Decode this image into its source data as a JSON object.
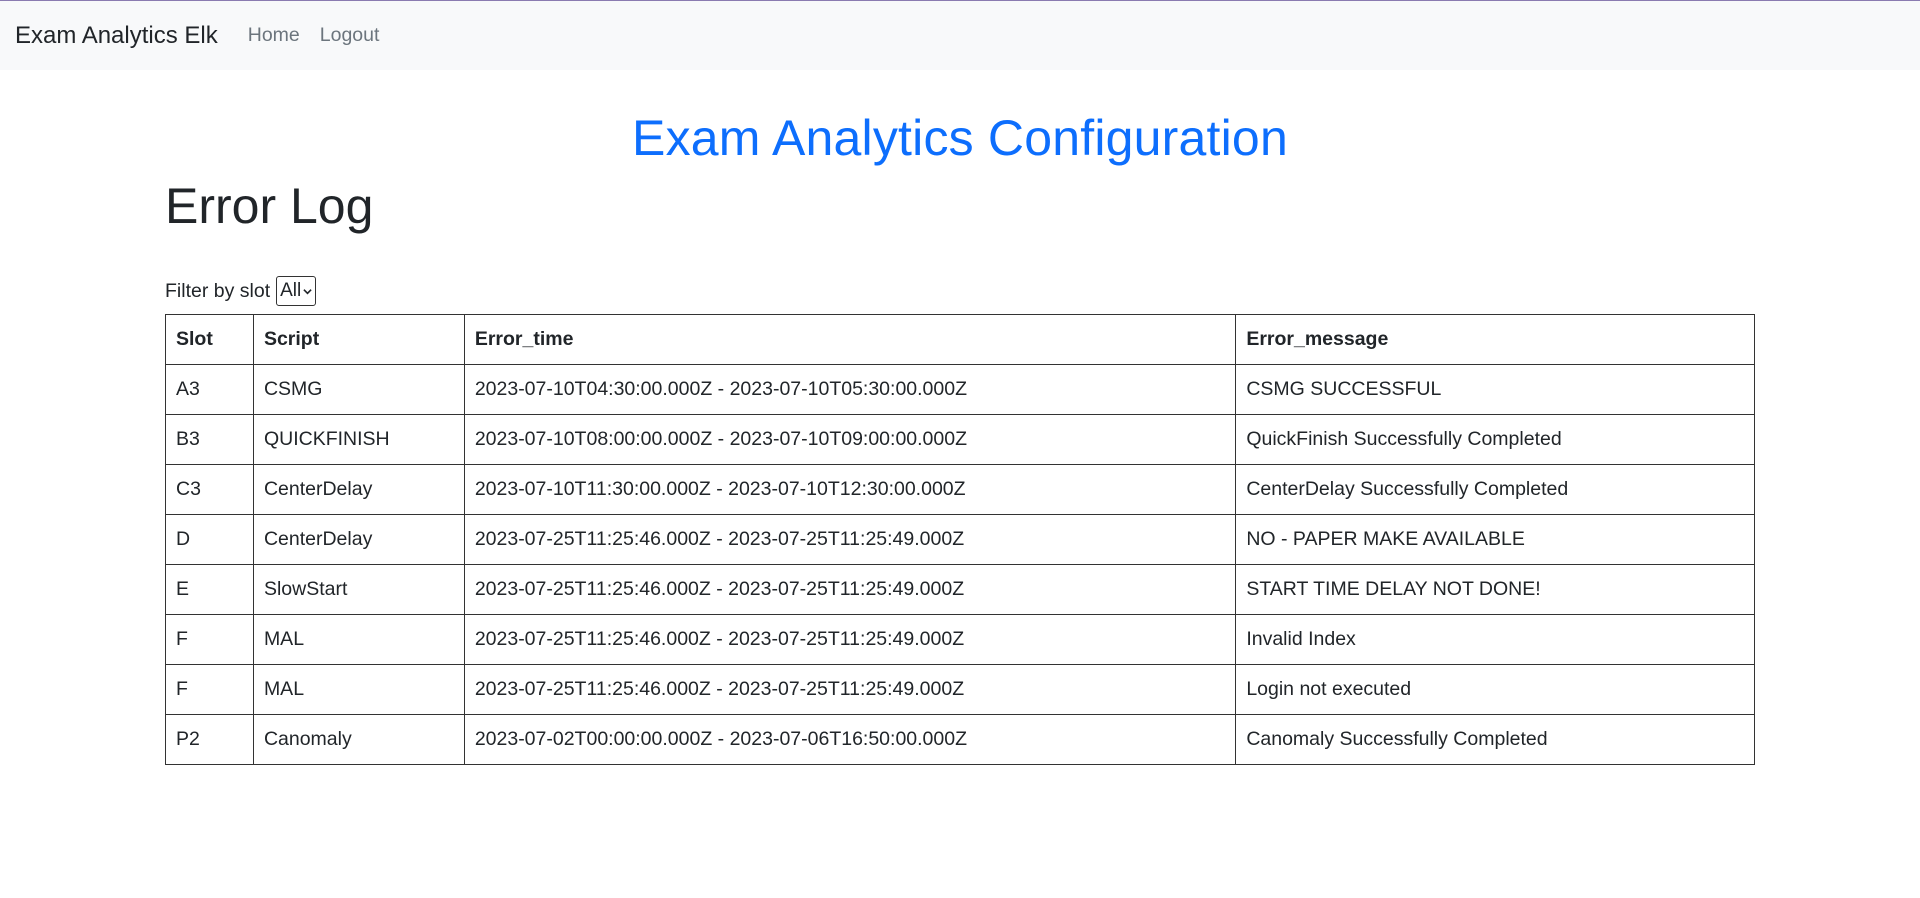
{
  "nav": {
    "brand": "Exam Analytics Elk",
    "links": [
      "Home",
      "Logout"
    ]
  },
  "header": {
    "config_title": "Exam Analytics Configuration"
  },
  "main": {
    "page_title": "Error Log",
    "filter": {
      "label": "Filter by slot",
      "selected": "All"
    },
    "table": {
      "columns": [
        "Slot",
        "Script",
        "Error_time",
        "Error_message"
      ],
      "rows": [
        [
          "A3",
          "CSMG",
          "2023-07-10T04:30:00.000Z - 2023-07-10T05:30:00.000Z",
          "CSMG SUCCESSFUL"
        ],
        [
          "B3",
          "QUICKFINISH",
          "2023-07-10T08:00:00.000Z - 2023-07-10T09:00:00.000Z",
          "QuickFinish Successfully Completed"
        ],
        [
          "C3",
          "CenterDelay",
          "2023-07-10T11:30:00.000Z - 2023-07-10T12:30:00.000Z",
          "CenterDelay Successfully Completed"
        ],
        [
          "D",
          "CenterDelay",
          "2023-07-25T11:25:46.000Z - 2023-07-25T11:25:49.000Z",
          "NO - PAPER MAKE AVAILABLE"
        ],
        [
          "E",
          "SlowStart",
          "2023-07-25T11:25:46.000Z - 2023-07-25T11:25:49.000Z",
          "START TIME DELAY NOT DONE!"
        ],
        [
          "F",
          "MAL",
          "2023-07-25T11:25:46.000Z - 2023-07-25T11:25:49.000Z",
          "Invalid Index"
        ],
        [
          "F",
          "MAL",
          "2023-07-25T11:25:46.000Z - 2023-07-25T11:25:49.000Z",
          "Login not executed"
        ],
        [
          "P2",
          "Canomaly",
          "2023-07-02T00:00:00.000Z - 2023-07-06T16:50:00.000Z",
          "Canomaly Successfully Completed"
        ]
      ]
    }
  },
  "colors": {
    "accent": "#0d6efd",
    "navbar_bg": "#f8f9fa",
    "text": "#212529",
    "nav_link": "#6c757d"
  },
  "icons": {
    "select_arrow": "chevron-down-icon"
  }
}
